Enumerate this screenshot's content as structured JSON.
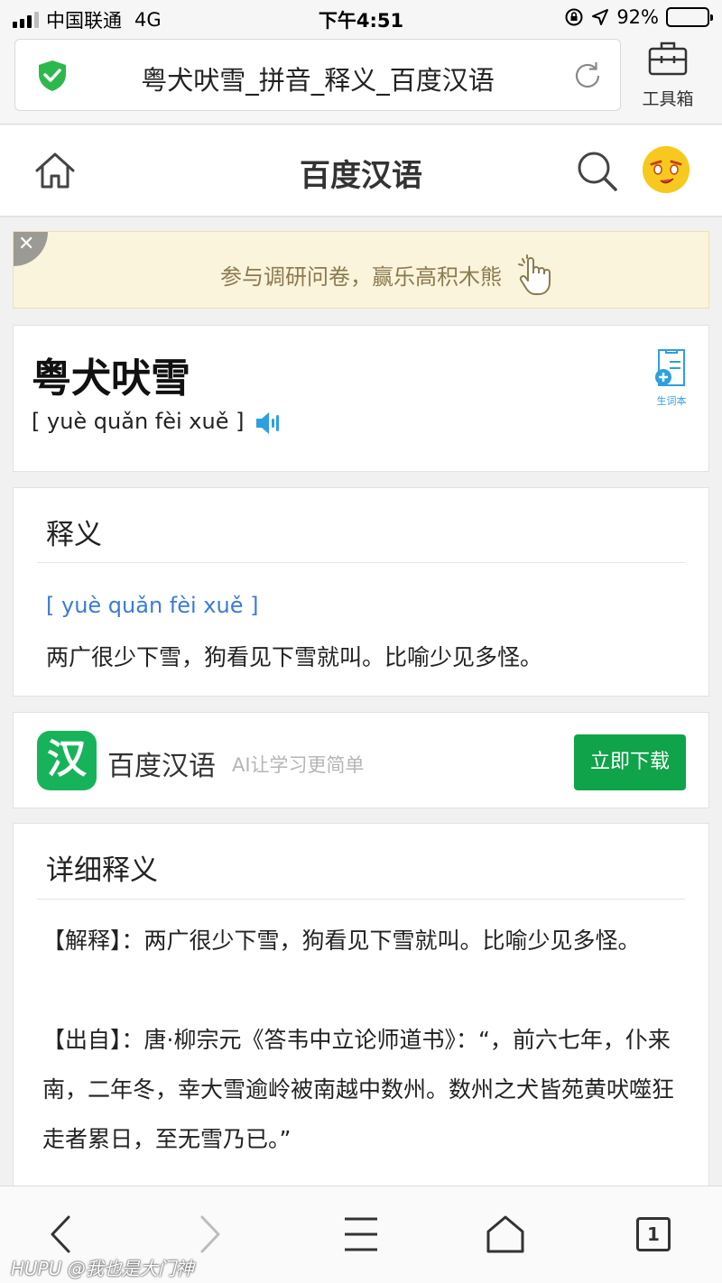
{
  "status_bar": {
    "carrier": "中国联通",
    "network": "4G",
    "time": "下午4:51",
    "battery": "92%",
    "battery_level": 0.92
  },
  "browser": {
    "page_title": "粤犬吠雪_拼音_释义_百度汉语",
    "toolbox_label": "工具箱"
  },
  "site_header": {
    "title": "百度汉语"
  },
  "survey_banner": {
    "text": "参与调研问卷，赢乐高积木熊",
    "close_glyph": "✕"
  },
  "word": {
    "title": "粤犬吠雪",
    "pinyin": "[ yuè quǎn fèi xuě ]",
    "vocab_label": "生词本"
  },
  "definition": {
    "heading": "释义",
    "pinyin": "[ yuè quǎn fèi xuě ]",
    "text": "两广很少下雪，狗看见下雪就叫。比喻少见多怪。"
  },
  "app_promo": {
    "icon_char": "汉",
    "name": "百度汉语",
    "slogan": "AI让学习更简单",
    "button": "立即下载"
  },
  "detail": {
    "heading": "详细释义",
    "explain": "【解释】：两广很少下雪，狗看见下雪就叫。比喻少见多怪。",
    "source": "【出自】：唐·柳宗元《答韦中立论师道书》：“，前六七年，仆来南，二年冬，幸大雪逾岭被南越中数州。数州之犬皆苑黄吠噬狂走者累日，至无雪乃已。”"
  },
  "bottom_bar": {
    "tab_count": "1"
  },
  "watermark": "HUPU @我也是大门神"
}
